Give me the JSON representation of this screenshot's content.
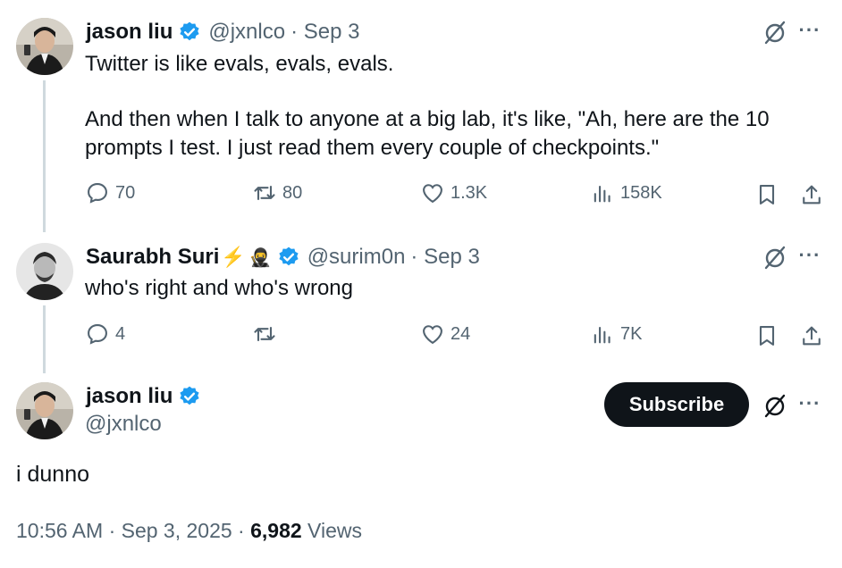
{
  "tweet1": {
    "name": "jason liu",
    "handle": "@jxnlco",
    "date": "· Sep 3",
    "line1": "Twitter is like evals, evals, evals.",
    "line2": "And then when I talk to anyone at a big lab, it's like, \"Ah, here are the 10",
    "line3": "prompts I test. I just read them every couple of checkpoints.\"",
    "replies": "70",
    "retweets": "80",
    "likes": "1.3K",
    "views": "158K"
  },
  "tweet2": {
    "name": "Saurabh Suri",
    "name_emojis": "⚡",
    "ninja": "🥷",
    "handle": "@surim0n",
    "date": "· Sep 3",
    "text": "who's right and who's wrong",
    "replies": "4",
    "retweets": "",
    "likes": "24",
    "views": "7K"
  },
  "main": {
    "name": "jason liu",
    "handle": "@jxnlco",
    "subscribe_label": "Subscribe",
    "text": "i dunno",
    "time": "10:56 AM · Sep 3, 2025 · ",
    "view_count": "6,982",
    "views_label": " Views"
  },
  "more_label": "···",
  "colors": {
    "verified": "#1d9bf0",
    "text": "#0f1419",
    "muted": "#536471",
    "line": "#cfd9de"
  }
}
